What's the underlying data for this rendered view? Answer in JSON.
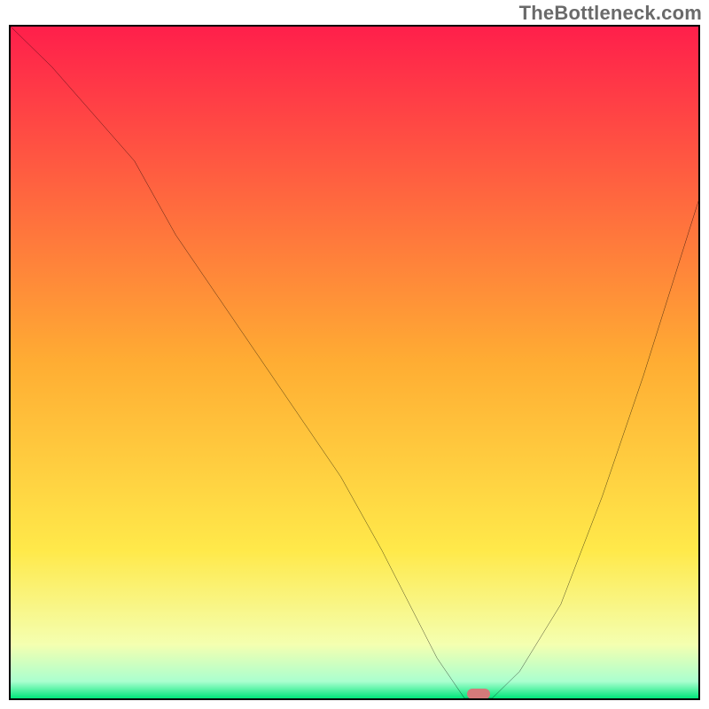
{
  "watermark": {
    "text": "TheBottleneck.com"
  },
  "chart_data": {
    "type": "line",
    "title": "",
    "xlabel": "",
    "ylabel": "",
    "xlim": [
      0,
      100
    ],
    "ylim": [
      0,
      100
    ],
    "axes_visible": false,
    "ticks_visible": false,
    "legend": false,
    "grid": false,
    "background": {
      "type": "vertical_gradient",
      "stops": [
        {
          "offset": 0.0,
          "color": "#ff1f4b"
        },
        {
          "offset": 0.5,
          "color": "#ffad33"
        },
        {
          "offset": 0.78,
          "color": "#ffe94a"
        },
        {
          "offset": 0.92,
          "color": "#f4ffb0"
        },
        {
          "offset": 0.975,
          "color": "#aaffcf"
        },
        {
          "offset": 1.0,
          "color": "#00e67a"
        }
      ]
    },
    "series": [
      {
        "name": "bottleneck-curve",
        "color": "#000000",
        "x": [
          0,
          6,
          12,
          18,
          24,
          30,
          36,
          42,
          48,
          54,
          58,
          62,
          66,
          70,
          74,
          80,
          86,
          92,
          100
        ],
        "y": [
          100,
          94,
          87,
          80,
          69,
          60,
          51,
          42,
          33,
          22,
          14,
          6,
          0,
          0,
          4,
          14,
          30,
          48,
          74
        ]
      }
    ],
    "marker": {
      "name": "optimal-point",
      "x": 68,
      "y": 0,
      "color": "#d47a7a"
    }
  }
}
